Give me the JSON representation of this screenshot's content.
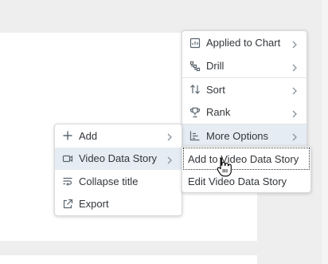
{
  "left_menu": {
    "items": [
      {
        "label": "Add",
        "icon": "plus-icon",
        "has_submenu": true
      },
      {
        "label": "Video Data Story",
        "icon": "video-icon",
        "has_submenu": true,
        "highlighted": true
      },
      {
        "label": "Collapse title",
        "icon": "collapse-title-icon",
        "has_submenu": false
      },
      {
        "label": "Export",
        "icon": "export-icon",
        "has_submenu": false
      }
    ]
  },
  "top_menu": {
    "items": [
      {
        "label": "Applied to Chart",
        "icon": "chart-filter-icon"
      },
      {
        "label": "Drill",
        "icon": "drill-icon"
      },
      {
        "label": "Sort",
        "icon": "sort-icon"
      },
      {
        "label": "Rank",
        "icon": "trophy-icon"
      },
      {
        "label": "More Options",
        "icon": "more-options-icon",
        "highlighted": true
      }
    ]
  },
  "video_submenu": {
    "items": [
      {
        "label": "Add to Video Data Story",
        "focused": true
      },
      {
        "label": "Edit Video Data Story"
      }
    ]
  },
  "colors": {
    "highlight": "#e5ecf3",
    "text": "#32363a",
    "icon": "#5a6670",
    "border": "#d9d9d9"
  }
}
